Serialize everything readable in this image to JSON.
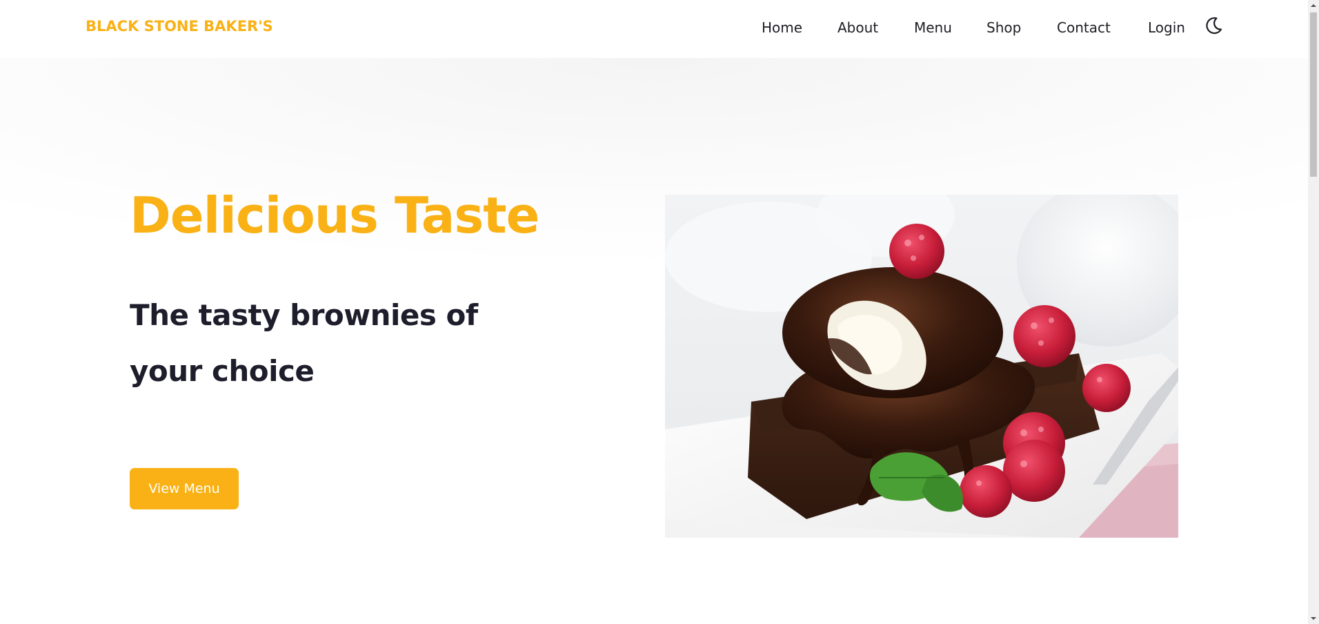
{
  "header": {
    "brand": "BLACK STONE BAKER'S",
    "nav": [
      "Home",
      "About",
      "Menu",
      "Shop",
      "Contact",
      "Login"
    ],
    "theme_toggle_icon": "moon-icon"
  },
  "hero": {
    "title": "Delicious Taste",
    "subtitle": "The tasty brownies of your choice",
    "cta_label": "View Menu",
    "image_icon": "brownie-with-ice-cream-and-raspberries-image"
  },
  "colors": {
    "accent": "#f9b115",
    "text_dark": "#1d1d2b",
    "nav_text": "#1d1d24",
    "background": "#ffffff"
  }
}
